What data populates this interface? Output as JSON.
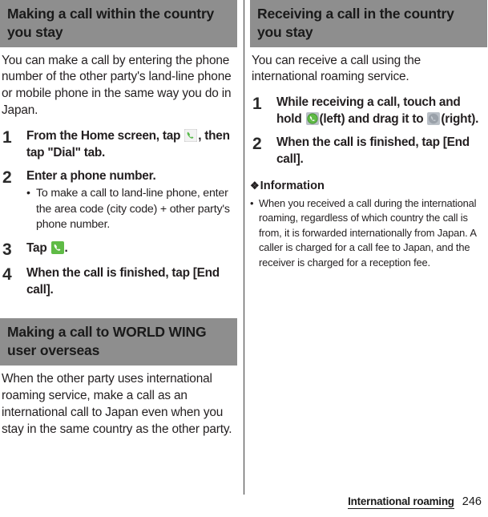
{
  "document": {
    "footer": {
      "section_label": "International roaming",
      "page_number": "246"
    }
  },
  "colors": {
    "section_header_bg": "#8e8e8e",
    "text": "#231f20",
    "accent_green": "#5fbb46",
    "icon_gray": "#8a8f96",
    "divider": "#3b3b3b"
  },
  "left_column": {
    "section1": {
      "heading": "Making a call within the country you stay",
      "intro": "You can make a call by entering the phone number of the other party's land-line phone or mobile phone in the same way you do in Japan.",
      "steps": [
        {
          "number": "1",
          "title_before": "From the Home screen, tap",
          "icon": "phone-handset-light-icon",
          "title_after": ", then tap \"Dial\" tab."
        },
        {
          "number": "2",
          "title_before": "Enter a phone number.",
          "icon": "",
          "title_after": "",
          "bullets": [
            {
              "marker": "•",
              "text": "To make a call to land-line phone, enter the area code (city code) + other party's phone number."
            }
          ]
        },
        {
          "number": "3",
          "title_before": "Tap",
          "icon": "phone-handset-green-icon",
          "title_after": "."
        },
        {
          "number": "4",
          "title_before": "When the call is finished, tap [End call].",
          "icon": "",
          "title_after": ""
        }
      ]
    },
    "section2": {
      "heading": "Making a call to WORLD WING user overseas",
      "intro": "When the other party uses international roaming service, make a call as an international call to Japan even when you stay in the same country as the other party."
    }
  },
  "right_column": {
    "section1": {
      "heading": "Receiving a call in the country you stay",
      "intro": "You can receive a call using the international roaming service.",
      "steps": [
        {
          "number": "1",
          "part1": "While receiving a call, touch and hold",
          "icon1": "answer-call-green-icon",
          "part2": "(left) and drag it to",
          "icon2": "end-call-gray-icon",
          "part3": "(right)."
        },
        {
          "number": "2",
          "part1": "When the call is finished, tap [End call].",
          "icon1": "",
          "part2": "",
          "icon2": "",
          "part3": ""
        }
      ]
    },
    "information": {
      "marker": "❖",
      "heading": "Information",
      "items": [
        {
          "marker": "•",
          "text": "When you received a call during the international roaming, regardless of which country the call is from, it is forwarded internationally from Japan. A caller is charged for a call fee to Japan, and the receiver is charged for a reception fee."
        }
      ]
    }
  }
}
